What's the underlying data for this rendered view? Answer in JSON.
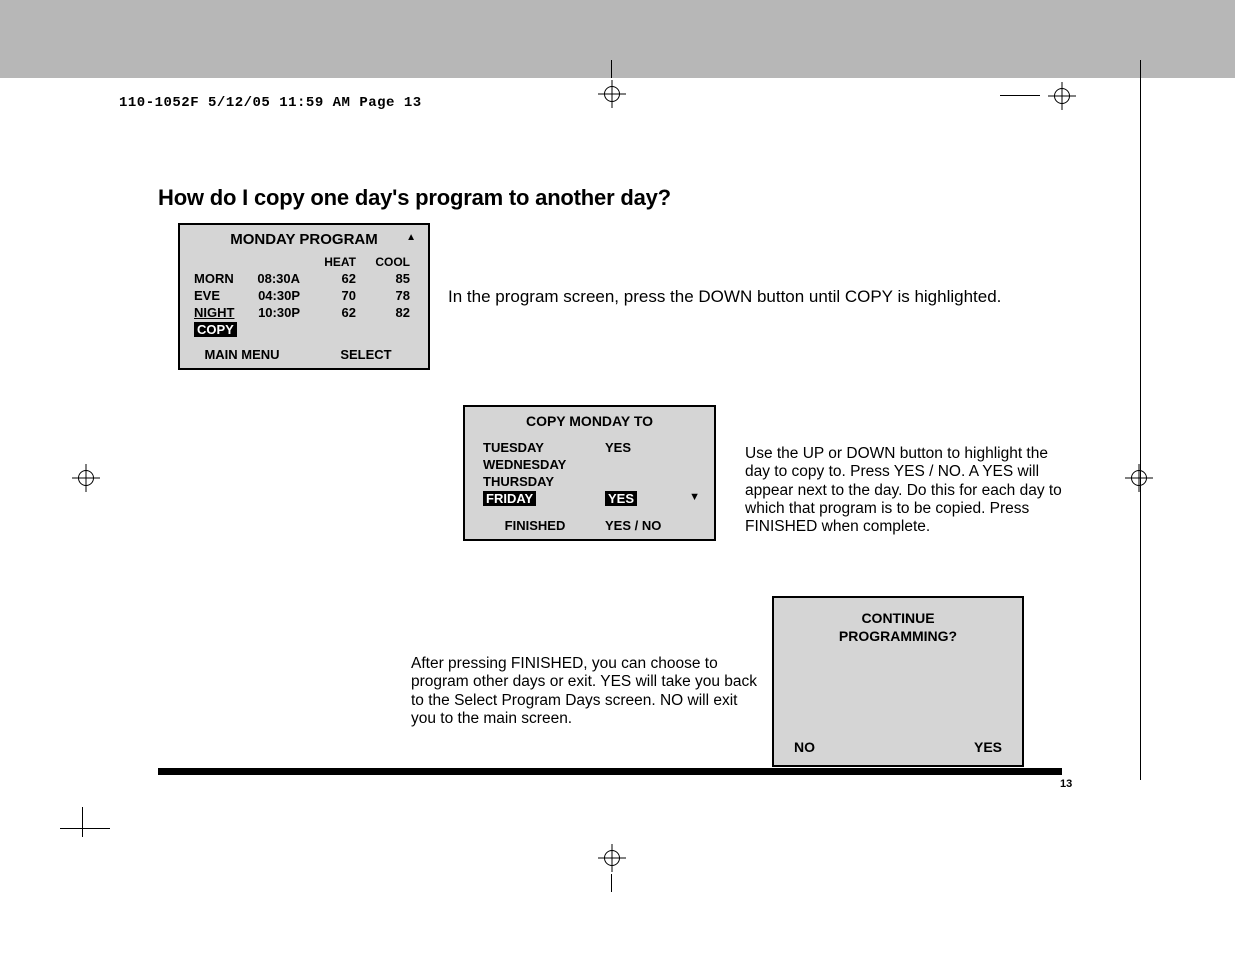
{
  "slug": "110-1052F  5/12/05  11:59 AM  Page 13",
  "heading": "How do I copy one day's program to another day?",
  "page_number": "13",
  "panel1": {
    "title": "MONDAY PROGRAM",
    "headers": {
      "heat": "HEAT",
      "cool": "COOL"
    },
    "rows": [
      {
        "period": "MORN",
        "time": "08:30A",
        "heat": "62",
        "cool": "85"
      },
      {
        "period": "EVE",
        "time": "04:30P",
        "heat": "70",
        "cool": "78"
      },
      {
        "period": "NIGHT",
        "time": "10:30P",
        "heat": "62",
        "cool": "82"
      }
    ],
    "copy_label": "COPY",
    "footer_left": "MAIN MENU",
    "footer_right": "SELECT"
  },
  "text1": "In the program screen, press the DOWN button until COPY is highlighted.",
  "panel2": {
    "title": "COPY MONDAY TO",
    "rows": [
      {
        "day": "TUESDAY",
        "yes": "YES"
      },
      {
        "day": "WEDNESDAY",
        "yes": ""
      },
      {
        "day": "THURSDAY",
        "yes": ""
      },
      {
        "day": "FRIDAY",
        "yes": "YES",
        "highlight": true
      }
    ],
    "footer_left": "FINISHED",
    "footer_right": "YES / NO"
  },
  "text2": "Use the UP or DOWN button to highlight the day to copy to. Press YES / NO. A YES will appear next to the day. Do this for each day to which that program is to be copied. Press FINISHED when complete.",
  "panel3": {
    "line1": "CONTINUE",
    "line2": "PROGRAMMING?",
    "no": "NO",
    "yes": "YES"
  },
  "text3": "After pressing FINISHED, you can choose to program other days or exit. YES will take you back to the Select Program Days screen. NO will exit you to the main screen."
}
